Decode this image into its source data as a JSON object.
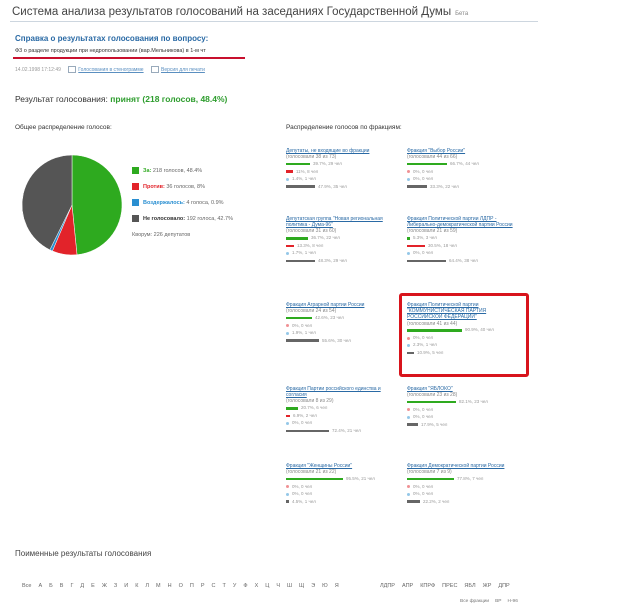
{
  "header": {
    "title": "Система анализа результатов голосований на заседаниях Государственной Думы",
    "beta": "Бета"
  },
  "reference": {
    "title": "Справка о результатах голосования по вопросу:",
    "question": "Ф3 о разделе продукции при недропользовании (вар.Мельникова) в 1-м чт",
    "datetime": "14.02.1998 17:12:49",
    "link_votes": "Голосования в стенограмме",
    "link_print": "Версия для печати"
  },
  "result": {
    "label": "Результат голосования:",
    "value": "принят (218 голосов, 48.4%)"
  },
  "overall": {
    "section_title": "Общее распределение голосов:",
    "legend": [
      {
        "label": "За:",
        "value": "218 голосов, 48.4%",
        "color": "#2eaa1f",
        "name": "legend-for"
      },
      {
        "label": "Против:",
        "value": "36 голосов, 8%",
        "color": "#e2232a",
        "name": "legend-against"
      },
      {
        "label": "Воздержалось:",
        "value": "4 голоса, 0.9%",
        "color": "#2a8fd1",
        "name": "legend-abstain"
      },
      {
        "label": "Не голосовало:",
        "value": "192 голоса, 42.7%",
        "color": "#555555",
        "name": "legend-absent"
      }
    ],
    "present": "Кворум: 226 депутатов",
    "pie": [
      48.4,
      8,
      0.9,
      42.7
    ]
  },
  "factions_title": "Распределение голосов по фракциям:",
  "factions": [
    {
      "name": "Депутаты, не входящие во фракции",
      "count": "(голосовали 38 из 73)",
      "rows": [
        {
          "color": "#2eaa1f",
          "frac": 0.397,
          "text": "39.7%, 29 чел"
        },
        {
          "color": "#e2232a",
          "frac": 0.11,
          "text": "11%, 8 чел"
        },
        {
          "color": "#2a8fd1",
          "frac": 0.014,
          "text": "1.4%, 1 чел"
        },
        {
          "color": "#666666",
          "frac": 0.479,
          "text": "47.9%, 35 чел"
        }
      ]
    },
    {
      "name": "Фракция \"Выбор России\"",
      "count": "(голосовали 44 из 66)",
      "rows": [
        {
          "color": "#2eaa1f",
          "frac": 0.667,
          "text": "66.7%, 44 чел"
        },
        {
          "color": "#e2232a",
          "frac": 0,
          "text": "0%, 0 чел"
        },
        {
          "color": "#2a8fd1",
          "frac": 0,
          "text": "0%, 0 чел"
        },
        {
          "color": "#666666",
          "frac": 0.333,
          "text": "33.3%, 22 чел"
        }
      ]
    },
    {
      "name": "Депутатская группа \"Новая региональная политика - Дума-96\"",
      "count": "(голосовали 31 из 60)",
      "rows": [
        {
          "color": "#2eaa1f",
          "frac": 0.367,
          "text": "36.7%, 22 чел"
        },
        {
          "color": "#e2232a",
          "frac": 0.133,
          "text": "13.3%, 8 чел"
        },
        {
          "color": "#2a8fd1",
          "frac": 0.017,
          "text": "1.7%, 1 чел"
        },
        {
          "color": "#666666",
          "frac": 0.483,
          "text": "48.3%, 29 чел"
        }
      ]
    },
    {
      "name": "Фракция Политической партии ЛДПР - Либерально-демократической партии России",
      "count": "(голосовали 21 из 59)",
      "rows": [
        {
          "color": "#2eaa1f",
          "frac": 0.053,
          "text": "5.3%, 3 чел"
        },
        {
          "color": "#e2232a",
          "frac": 0.305,
          "text": "30.5%, 18 чел"
        },
        {
          "color": "#2a8fd1",
          "frac": 0,
          "text": "0%, 0 чел"
        },
        {
          "color": "#666666",
          "frac": 0.644,
          "text": "64.4%, 38 чел"
        }
      ]
    },
    {
      "name": "Фракция Аграрной партии России",
      "count": "(голосовали 24 из 54)",
      "rows": [
        {
          "color": "#2eaa1f",
          "frac": 0.426,
          "text": "42.6%, 23 чел"
        },
        {
          "color": "#e2232a",
          "frac": 0,
          "text": "0%, 0 чел"
        },
        {
          "color": "#2a8fd1",
          "frac": 0.019,
          "text": "1.9%, 1 чел"
        },
        {
          "color": "#666666",
          "frac": 0.556,
          "text": "55.6%, 30 чел"
        }
      ]
    },
    {
      "name": "Фракция Политической партии \"КОММУНИСТИЧЕСКАЯ ПАРТИЯ РОССИЙСКОЙ ФЕДЕРАЦИИ\"",
      "count": "(голосовали 41 из 44)",
      "rows": [
        {
          "color": "#2eaa1f",
          "frac": 0.909,
          "text": "90.9%, 40 чел"
        },
        {
          "color": "#e2232a",
          "frac": 0,
          "text": "0%, 0 чел"
        },
        {
          "color": "#2a8fd1",
          "frac": 0.023,
          "text": "2.3%, 1 чел"
        },
        {
          "color": "#666666",
          "frac": 0.109,
          "text": "10.9%, 5 чел"
        }
      ]
    },
    {
      "name": "Фракция Партии российского единства и согласия",
      "count": "(голосовали 8 из 29)",
      "rows": [
        {
          "color": "#2eaa1f",
          "frac": 0.207,
          "text": "20.7%, 6 чел"
        },
        {
          "color": "#e2232a",
          "frac": 0.069,
          "text": "6.9%, 2 чел"
        },
        {
          "color": "#2a8fd1",
          "frac": 0,
          "text": "0%, 0 чел"
        },
        {
          "color": "#666666",
          "frac": 0.724,
          "text": "72.4%, 21 чел"
        }
      ]
    },
    {
      "name": "Фракция \"ЯБЛОКО\"",
      "count": "(голосовали 23 из 28)",
      "rows": [
        {
          "color": "#2eaa1f",
          "frac": 0.821,
          "text": "82.1%, 23 чел"
        },
        {
          "color": "#e2232a",
          "frac": 0,
          "text": "0%, 0 чел"
        },
        {
          "color": "#2a8fd1",
          "frac": 0,
          "text": "0%, 0 чел"
        },
        {
          "color": "#666666",
          "frac": 0.179,
          "text": "17.9%, 5 чел"
        }
      ]
    },
    {
      "name": "Фракция \"Женщины России\"",
      "count": "(голосовали 21 из 22)",
      "rows": [
        {
          "color": "#2eaa1f",
          "frac": 0.955,
          "text": "95.5%, 21 чел"
        },
        {
          "color": "#e2232a",
          "frac": 0,
          "text": "0%, 0 чел"
        },
        {
          "color": "#2a8fd1",
          "frac": 0,
          "text": "0%, 0 чел"
        },
        {
          "color": "#666666",
          "frac": 0.045,
          "text": "4.5%, 1 чел"
        }
      ]
    },
    {
      "name": "Фракция Демократической партии России",
      "count": "(голосовали 7 из 9)",
      "rows": [
        {
          "color": "#2eaa1f",
          "frac": 0.778,
          "text": "77.8%, 7 чел"
        },
        {
          "color": "#e2232a",
          "frac": 0,
          "text": "0%, 0 чел"
        },
        {
          "color": "#2a8fd1",
          "frac": 0,
          "text": "0%, 0 чел"
        },
        {
          "color": "#666666",
          "frac": 0.222,
          "text": "22.2%, 2 чел"
        }
      ]
    }
  ],
  "named_results": {
    "title": "Поименные результаты голосования"
  },
  "alphabet": {
    "prefix": "Все",
    "letters": [
      "А",
      "Б",
      "В",
      "Г",
      "Д",
      "Е",
      "Ж",
      "З",
      "И",
      "К",
      "Л",
      "М",
      "Н",
      "О",
      "П",
      "Р",
      "С",
      "Т",
      "У",
      "Ф",
      "Х",
      "Ц",
      "Ч",
      "Ш",
      "Щ",
      "Э",
      "Ю",
      "Я"
    ],
    "factions": [
      "ЛДПР",
      "АПР",
      "КПРФ",
      "ПРЕС",
      "ЯБЛ",
      "ЖР",
      "ДПР"
    ]
  },
  "bottom_links": [
    "Все фракции",
    "ВР",
    "Н-96"
  ]
}
